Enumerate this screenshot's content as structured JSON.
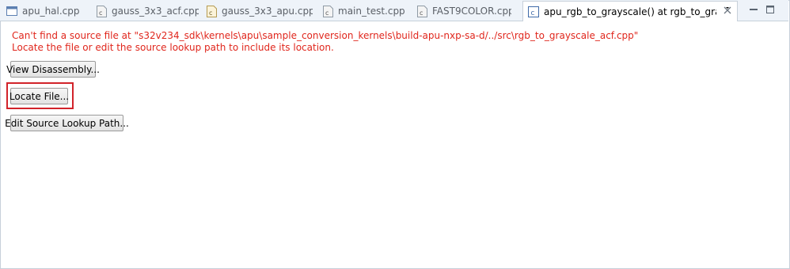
{
  "tabs": [
    {
      "label": "apu_hal.cpp",
      "icon": "editor-file-icon"
    },
    {
      "label": "gauss_3x3_acf.cpp",
      "icon": "c-file-icon"
    },
    {
      "label": "gauss_3x3_apu.cpp",
      "icon": "c-file-icon"
    },
    {
      "label": "main_test.cpp",
      "icon": "c-file-icon"
    },
    {
      "label": "FAST9COLOR.cpp",
      "icon": "c-file-icon"
    },
    {
      "label": "apu_rgb_to_grayscale() at rgb_to_grayscal...",
      "icon": "c-editor-icon",
      "active": true
    }
  ],
  "error": {
    "line1": "Can't find a source file at \"s32v234_sdk\\kernels\\apu\\sample_conversion_kernels\\build-apu-nxp-sa-d/../src\\rgb_to_grayscale_acf.cpp\"",
    "line2": "Locate the file or edit the source lookup path to include its location."
  },
  "buttons": {
    "view_disassembly": "View Disassembly...",
    "locate_file": "Locate File...",
    "edit_lookup": "Edit Source Lookup Path..."
  },
  "colors": {
    "error_text": "#e0261c",
    "highlight_border": "#d2232a",
    "tabbar_bg": "#eef3f9"
  }
}
